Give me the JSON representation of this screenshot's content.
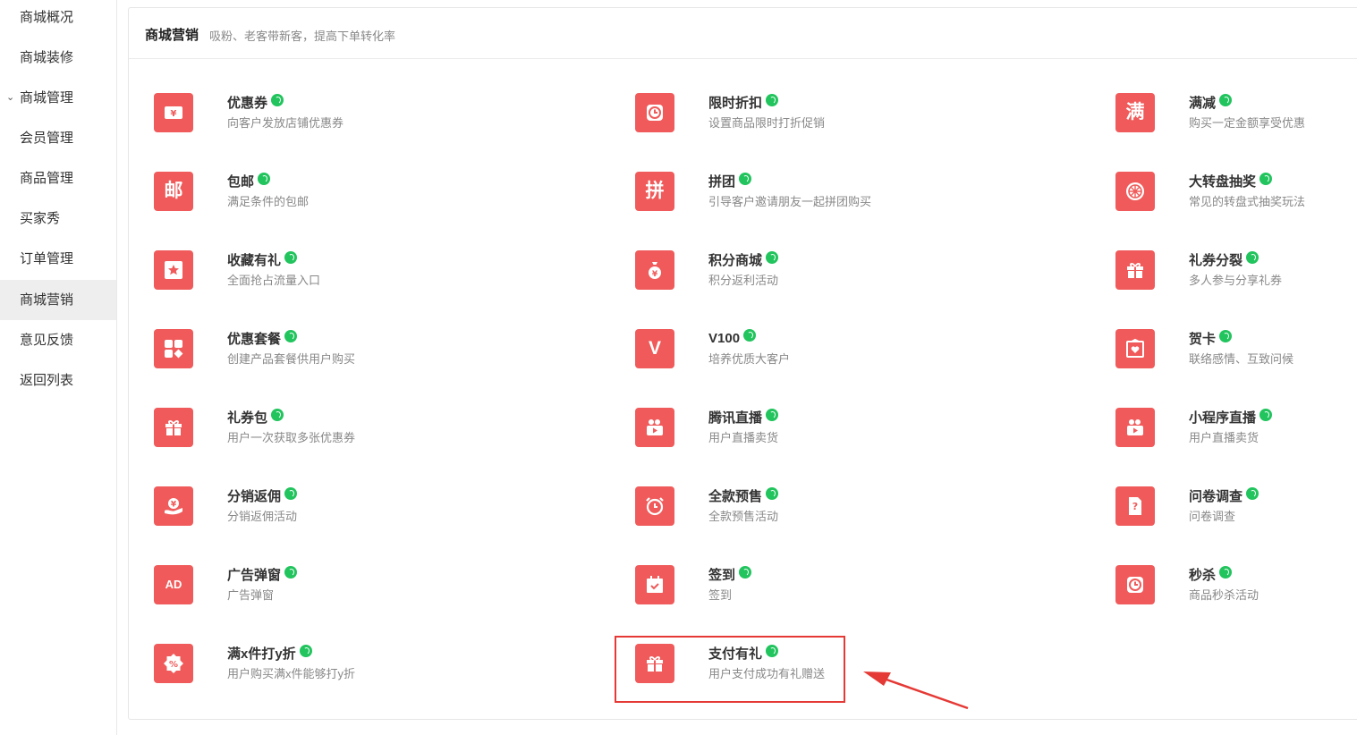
{
  "sidebar": {
    "items": [
      {
        "label": "商城概况"
      },
      {
        "label": "商城装修"
      },
      {
        "label": "商城管理"
      },
      {
        "label": "会员管理"
      },
      {
        "label": "商品管理"
      },
      {
        "label": "买家秀"
      },
      {
        "label": "订单管理"
      },
      {
        "label": "商城营销"
      },
      {
        "label": "意见反馈"
      },
      {
        "label": "返回列表"
      }
    ]
  },
  "header": {
    "title": "商城营销",
    "subtitle": "吸粉、老客带新客，提高下单转化率"
  },
  "colors": {
    "accent": "#f05a5a",
    "badge": "#21c45d",
    "highlight": "#e53935"
  },
  "cards": [
    {
      "name": "优惠券",
      "desc": "向客户发放店铺优惠券",
      "icon": "coupon-icon"
    },
    {
      "name": "限时折扣",
      "desc": "设置商品限时打折促销",
      "icon": "clock-icon"
    },
    {
      "name": "满减",
      "desc": "购买一定金额享受优惠",
      "icon": "man-icon",
      "glyph": "满"
    },
    {
      "name": "包邮",
      "desc": "满足条件的包邮",
      "icon": "you-icon",
      "glyph": "邮"
    },
    {
      "name": "拼团",
      "desc": "引导客户邀请朋友一起拼团购买",
      "icon": "pin-icon",
      "glyph": "拼"
    },
    {
      "name": "大转盘抽奖",
      "desc": "常见的转盘式抽奖玩法",
      "icon": "wheel-icon"
    },
    {
      "name": "收藏有礼",
      "desc": "全面抢占流量入口",
      "icon": "star-icon"
    },
    {
      "name": "积分商城",
      "desc": "积分返利活动",
      "icon": "money-bag-icon"
    },
    {
      "name": "礼券分裂",
      "desc": "多人参与分享礼券",
      "icon": "gift-icon"
    },
    {
      "name": "优惠套餐",
      "desc": "创建产品套餐供用户购买",
      "icon": "grid-icon"
    },
    {
      "name": "V100",
      "desc": "培养优质大客户",
      "icon": "v100-icon",
      "glyph": "V"
    },
    {
      "name": "贺卡",
      "desc": "联络感情、互致问候",
      "icon": "card-heart-icon"
    },
    {
      "name": "礼券包",
      "desc": "用户一次获取多张优惠券",
      "icon": "gift-icon"
    },
    {
      "name": "腾讯直播",
      "desc": "用户直播卖货",
      "icon": "camera-icon"
    },
    {
      "name": "小程序直播",
      "desc": "用户直播卖货",
      "icon": "camera-icon"
    },
    {
      "name": "分销返佣",
      "desc": "分销返佣活动",
      "icon": "hand-coin-icon"
    },
    {
      "name": "全款预售",
      "desc": "全款预售活动",
      "icon": "alarm-icon"
    },
    {
      "name": "问卷调查",
      "desc": "问卷调查",
      "icon": "survey-icon"
    },
    {
      "name": "广告弹窗",
      "desc": "广告弹窗",
      "icon": "ad-icon",
      "glyph": "AD"
    },
    {
      "name": "签到",
      "desc": "签到",
      "icon": "calendar-check-icon"
    },
    {
      "name": "秒杀",
      "desc": "商品秒杀活动",
      "icon": "clock-icon"
    },
    {
      "name": "满x件打y折",
      "desc": "用户购买满x件能够打y折",
      "icon": "discount-icon"
    },
    {
      "name": "支付有礼",
      "desc": "用户支付成功有礼赠送",
      "icon": "gift-icon"
    }
  ]
}
